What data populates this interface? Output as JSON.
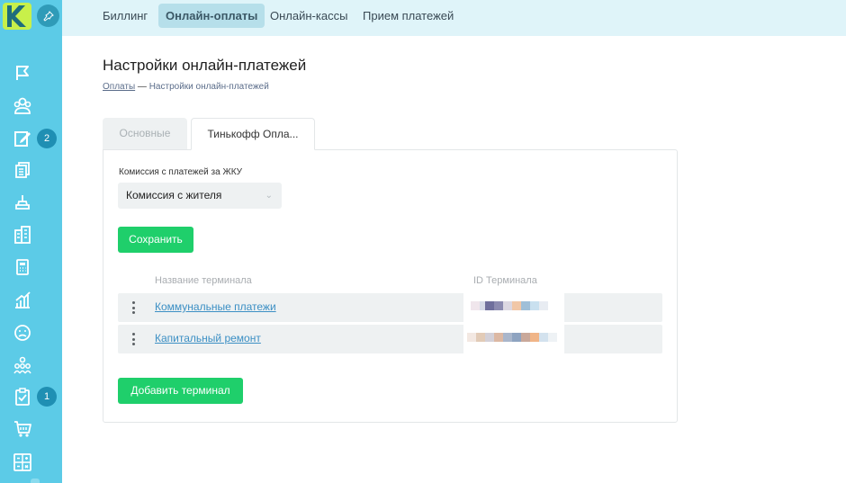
{
  "sidebar": {
    "logo_letter": "K",
    "badges": {
      "tasks": "2",
      "checklist": "1"
    },
    "items": [
      {
        "icon": "flag-icon"
      },
      {
        "icon": "people-icon"
      },
      {
        "icon": "edit-document-icon"
      },
      {
        "icon": "documents-icon"
      },
      {
        "icon": "stamp-icon"
      },
      {
        "icon": "buildings-icon"
      },
      {
        "icon": "calculator-icon"
      },
      {
        "icon": "chart-growth-icon"
      },
      {
        "icon": "sad-face-icon"
      },
      {
        "icon": "group-icon"
      },
      {
        "icon": "clipboard-check-icon"
      },
      {
        "icon": "cart-icon"
      },
      {
        "icon": "spreadsheet-icon"
      }
    ],
    "accent_color": "#5ccbe7"
  },
  "topnav": {
    "tabs": [
      {
        "label": "Биллинг"
      },
      {
        "label": "Онлайн-оплаты"
      },
      {
        "label": "Онлайн-кассы"
      },
      {
        "label": "Прием платежей"
      }
    ],
    "active_tab": "Онлайн-оплаты"
  },
  "page": {
    "title": "Настройки онлайн-платежей",
    "breadcrumb": {
      "link": "Оплаты",
      "separator": "—",
      "current": "Настройки онлайн-платежей"
    }
  },
  "subtabs": [
    {
      "label": "Основные"
    },
    {
      "label": "Тинькофф Опла..."
    }
  ],
  "form": {
    "commission_label": "Комиссия с платежей за ЖКУ",
    "commission_value": "Комиссия с жителя",
    "save_label": "Сохранить",
    "add_terminal_label": "Добавить терминал",
    "button_color": "#1fcf6b"
  },
  "terminals": {
    "columns": {
      "name": "Название терминала",
      "id": "ID Терминала"
    },
    "rows": [
      {
        "name": "Коммунальные платежи"
      },
      {
        "name": "Капитальный ремонт"
      }
    ],
    "id_values_obscured": true
  }
}
